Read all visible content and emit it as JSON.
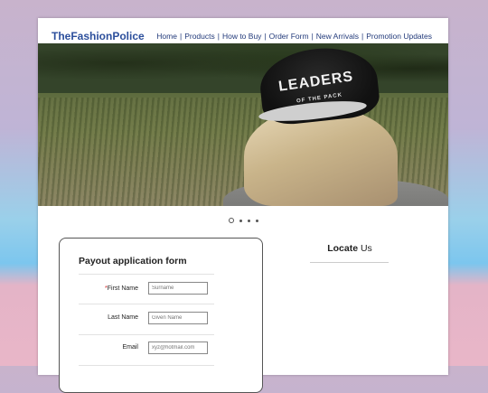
{
  "site": {
    "logo": "TheFashionPolice"
  },
  "nav": {
    "items": [
      {
        "label": "Home"
      },
      {
        "label": "Products"
      },
      {
        "label": "How to Buy"
      },
      {
        "label": "Order Form"
      },
      {
        "label": "New Arrivals"
      },
      {
        "label": "Promotion Updates"
      }
    ],
    "separator": "|"
  },
  "hero": {
    "cap_text_main": "LEADERS",
    "cap_text_sub": "OF THE PACK",
    "slide_count": 4,
    "active_slide": 1
  },
  "form": {
    "title": "Payout application form",
    "required_mark": "*",
    "fields": [
      {
        "label": "First Name",
        "placeholder": "Surname",
        "required": true
      },
      {
        "label": "Last Name",
        "placeholder": "Given Name",
        "required": false
      },
      {
        "label": "Email",
        "placeholder": "xyz@hotmail.com",
        "required": false
      }
    ]
  },
  "locate": {
    "bold": "Locate",
    "rest": " Us"
  }
}
